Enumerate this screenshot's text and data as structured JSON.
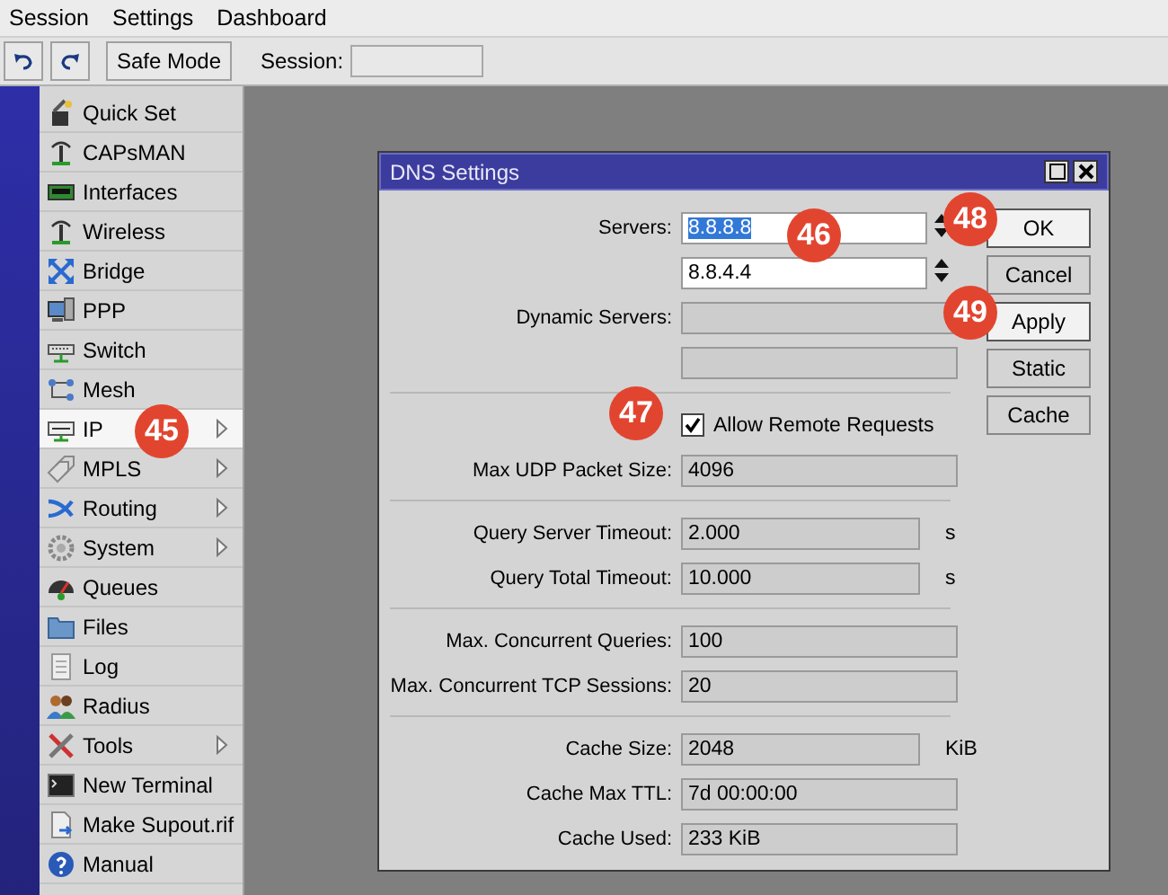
{
  "menu": [
    "Session",
    "Settings",
    "Dashboard"
  ],
  "toolbar": {
    "safe_mode": "Safe Mode",
    "session_label": "Session:"
  },
  "sidebar": {
    "items": [
      {
        "label": "Quick Set",
        "selected": false,
        "submenu": false
      },
      {
        "label": "CAPsMAN",
        "selected": false,
        "submenu": false
      },
      {
        "label": "Interfaces",
        "selected": false,
        "submenu": false
      },
      {
        "label": "Wireless",
        "selected": false,
        "submenu": false
      },
      {
        "label": "Bridge",
        "selected": false,
        "submenu": false
      },
      {
        "label": "PPP",
        "selected": false,
        "submenu": false
      },
      {
        "label": "Switch",
        "selected": false,
        "submenu": false
      },
      {
        "label": "Mesh",
        "selected": false,
        "submenu": false
      },
      {
        "label": "IP",
        "selected": true,
        "submenu": true
      },
      {
        "label": "MPLS",
        "selected": false,
        "submenu": true
      },
      {
        "label": "Routing",
        "selected": false,
        "submenu": true
      },
      {
        "label": "System",
        "selected": false,
        "submenu": true
      },
      {
        "label": "Queues",
        "selected": false,
        "submenu": false
      },
      {
        "label": "Files",
        "selected": false,
        "submenu": false
      },
      {
        "label": "Log",
        "selected": false,
        "submenu": false
      },
      {
        "label": "Radius",
        "selected": false,
        "submenu": false
      },
      {
        "label": "Tools",
        "selected": false,
        "submenu": true
      },
      {
        "label": "New Terminal",
        "selected": false,
        "submenu": false
      },
      {
        "label": "Make Supout.rif",
        "selected": false,
        "submenu": false
      },
      {
        "label": "Manual",
        "selected": false,
        "submenu": false
      }
    ]
  },
  "dialog": {
    "title": "DNS Settings",
    "rows": [
      {
        "kind": "server",
        "label": "Servers:",
        "value": "8.8.8.8",
        "selected": true
      },
      {
        "kind": "server",
        "value": "8.8.4.4",
        "selected": false
      },
      {
        "kind": "field",
        "label": "Dynamic Servers:"
      },
      {
        "kind": "field"
      },
      {
        "kind": "divider"
      },
      {
        "kind": "checkbox",
        "label": "Allow Remote Requests",
        "checked": true
      },
      {
        "kind": "field",
        "label": "Max UDP Packet Size:",
        "value": "4096"
      },
      {
        "kind": "divider"
      },
      {
        "kind": "field",
        "label": "Query Server Timeout:",
        "value": "2.000",
        "unit": "s"
      },
      {
        "kind": "field",
        "label": "Query Total Timeout:",
        "value": "10.000",
        "unit": "s"
      },
      {
        "kind": "divider"
      },
      {
        "kind": "field",
        "label": "Max. Concurrent Queries:",
        "value": "100"
      },
      {
        "kind": "field",
        "label": "Max. Concurrent TCP Sessions:",
        "value": "20"
      },
      {
        "kind": "divider"
      },
      {
        "kind": "field",
        "label": "Cache Size:",
        "value": "2048",
        "unit": "KiB"
      },
      {
        "kind": "field",
        "label": "Cache Max TTL:",
        "value": "7d 00:00:00"
      },
      {
        "kind": "field",
        "label": "Cache Used:",
        "value": "233 KiB"
      }
    ],
    "buttons": [
      {
        "label": "OK",
        "highlighted": true
      },
      {
        "label": "Cancel",
        "highlighted": false
      },
      {
        "label": "Apply",
        "highlighted": true
      },
      {
        "label": "Static",
        "highlighted": false
      },
      {
        "label": "Cache",
        "highlighted": false
      }
    ]
  },
  "annotations": [
    {
      "text": "45"
    },
    {
      "text": "46"
    },
    {
      "text": "47"
    },
    {
      "text": "48"
    },
    {
      "text": "49"
    }
  ]
}
